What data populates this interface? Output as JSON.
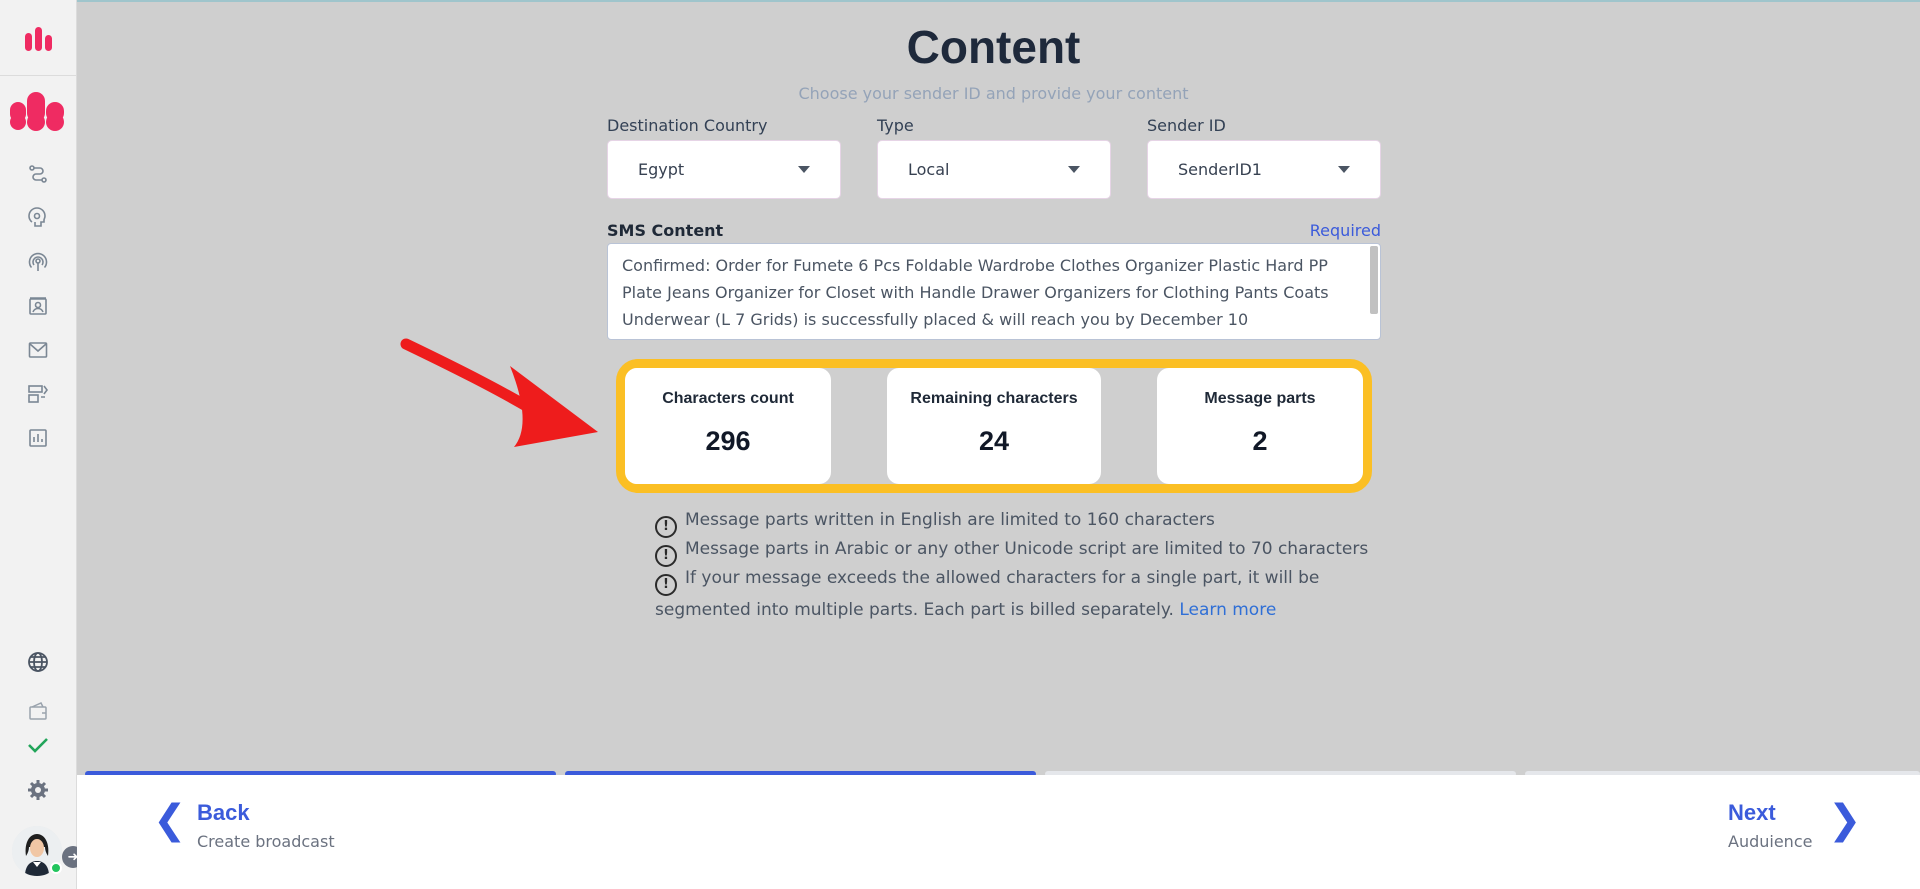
{
  "header": {
    "title": "Content",
    "subtitle": "Choose your sender ID and provide your content"
  },
  "form": {
    "country_label": "Destination Country",
    "country_value": "Egypt",
    "type_label": "Type",
    "type_value": "Local",
    "sender_label": "Sender ID",
    "sender_value": "SenderID1",
    "sms_label": "SMS Content",
    "required_label": "Required",
    "sms_text": "Confirmed: Order for Fumete 6 Pcs Foldable Wardrobe Clothes Organizer Plastic Hard PP Plate Jeans Organizer for Closet with Handle Drawer Organizers for Clothing Pants Coats Underwear (L 7 Grids)  is successfully placed & will reach you by December 10"
  },
  "stats": [
    {
      "label": "Characters count",
      "value": "296"
    },
    {
      "label": "Remaining characters",
      "value": "24"
    },
    {
      "label": "Message parts",
      "value": "2"
    }
  ],
  "info": {
    "line1": "Message parts written in English are limited to 160 characters",
    "line2": "Message parts in Arabic or any other Unicode script are limited to 70 characters",
    "line3": "If your message exceeds the allowed characters for a single part, it will be segmented into multiple parts. Each part is billed separately.",
    "learn_more": "Learn more"
  },
  "progress": {
    "completed_color": "#3b5bdb",
    "pending_color": "#e5e7eb",
    "steps_completed": 2,
    "steps_total": 4
  },
  "footer": {
    "back_label": "Back",
    "back_sub": "Create broadcast",
    "next_label": "Next",
    "next_sub": "Auduience"
  },
  "colors": {
    "brand": "#ef2b62",
    "highlight": "#fbbf24",
    "arrow": "#ee1c1c"
  }
}
